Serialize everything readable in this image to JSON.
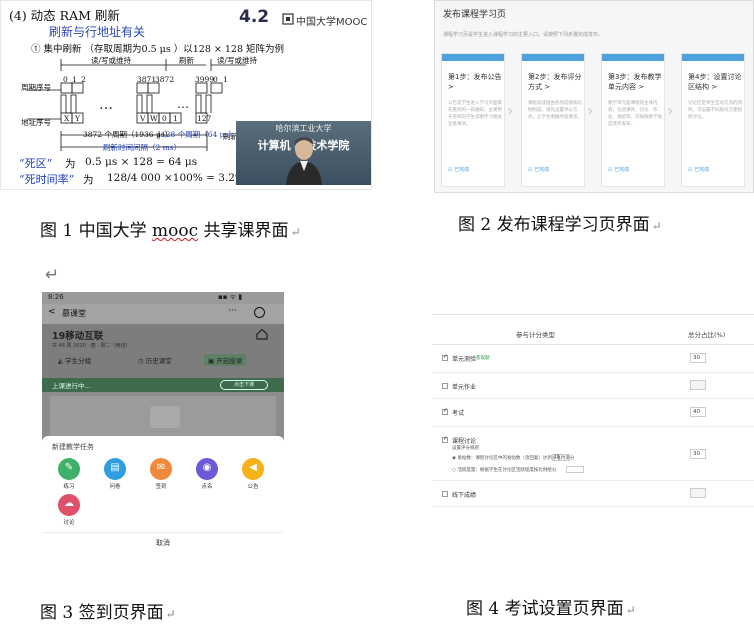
{
  "fig1": {
    "heading": "(4)  动态 RAM 刷新",
    "subheading": "刷新与行地址有关",
    "bullet": "① 集中刷新 （存取周期为0.5 μs ）以128 × 128 矩阵为例",
    "chapter": "4.2",
    "logo_text": "中国大学MOOC",
    "label_cycle": "周期序号",
    "label_addr": "地址序号",
    "label_rw1": "读/写或维持",
    "label_refresh": "刷新",
    "label_rw2": "读/写或维持",
    "label_refresh_seq": "刷新序号",
    "cycle_ticks": [
      "0",
      "1",
      "2",
      "3871",
      "3872",
      "3999",
      "0",
      "1"
    ],
    "addr_cells": [
      "X",
      "Y",
      "V",
      "W",
      "0",
      "1",
      "127"
    ],
    "ellipsis": "…",
    "span_1": "3872 个周期（1936 μs）",
    "span_2": "128 个周期（64 μs）",
    "span_total": "刷新时间间隔（2 ms）",
    "dead_zone_label": "“死区”",
    "dead_zone_word": "为",
    "dead_zone_value": "0.5 μs × 128 = 64 μs",
    "dead_rate_label": "“死时间率”",
    "dead_rate_word": "为",
    "dead_rate_value": "128/4 000 ×100% = 3.2%",
    "video_school": "哈尔滨工业大学",
    "video_college": "计算机    与技术学院"
  },
  "fig2": {
    "title": "发布课程学习页",
    "description": "课程学习页是学生进入课程学习的主要入口，请按照下列步骤完成发布。",
    "steps": [
      {
        "title": "第1步：发布公告 >",
        "desc": "公告是学生进入学习页面最先看到的一则通知，主要用于老师向学生说明学习相关注意事项。",
        "done": "已完成"
      },
      {
        "title": "第2步：发布评分方式 >",
        "desc": "课程总成绩由各项成绩按比例构成，请先设置评分方式，让学生明确考核要求。",
        "done": "已完成"
      },
      {
        "title": "第3步：发布教学单元内容 >",
        "desc": "教学单元是课程的主体内容，包括课件、讨论、作业、测验等，可按照教学进度逐步发布。",
        "done": "已完成"
      },
      {
        "title": "第4步：设置讨论区结构 >",
        "desc": "讨论区是师生互动交流的场所，可设置不同版块方便组织讨论。",
        "done": "已完成"
      }
    ]
  },
  "fig3": {
    "return_mark": "↵",
    "status_time": "8:26",
    "status_icons": "▪▪ ᯤ ▮",
    "back": "<",
    "app_title": "慕课堂",
    "more": "···",
    "course_name": "19移动互联",
    "course_info": "共 48 周 2020 · 春 · 周二（两班）",
    "chips": [
      "学生分组",
      "历史课堂",
      "开启授课"
    ],
    "live_text": "上课进行中...",
    "live_button": "点击下课",
    "sheet_title": "新建教学任务",
    "tasks": [
      {
        "label": "练习",
        "color": "#3fb06a",
        "glyph": "✎"
      },
      {
        "label": "问卷",
        "color": "#2f9ee0",
        "glyph": "▤"
      },
      {
        "label": "签到",
        "color": "#ef8a3c",
        "glyph": "✉"
      },
      {
        "label": "点名",
        "color": "#6b5ad8",
        "glyph": "◉"
      },
      {
        "label": "公告",
        "color": "#f5b21b",
        "glyph": "◀"
      },
      {
        "label": "讨论",
        "color": "#e0506a",
        "glyph": "☁"
      }
    ],
    "cancel": "取消"
  },
  "fig4": {
    "col_type": "参与计分类型",
    "col_ratio": "总分占比(%)",
    "rows": [
      {
        "label": "单元测验",
        "badge": "客观题",
        "checked": true,
        "value": "30"
      },
      {
        "label": "单元作业",
        "badge": "",
        "checked": false,
        "value": ""
      },
      {
        "label": "考试",
        "badge": "",
        "checked": true,
        "value": "40"
      },
      {
        "label": "课程讨论",
        "badge": "",
        "checked": true,
        "value": "30"
      },
      {
        "label": "线下成绩",
        "badge": "",
        "checked": false,
        "value": ""
      }
    ],
    "discuss_sub_title": "设置评分规则",
    "discuss_sub_a": "发帖数：课程讨论区中的发帖数（含回复）达到标准时满分",
    "discuss_sub_a_val": "15",
    "discuss_sub_b": "活跃度量：根据学生在讨论区活跃程度按比例给分",
    "discuss_sub_b_val": ""
  },
  "captions": {
    "c1_pre": "图 1 中国大学 ",
    "c1_mooc": "mooc",
    "c1_post": " 共享课界面",
    "c2": "图 2  发布课程学习页界面",
    "c3": "图 3 签到页界面",
    "c4": "图 4 考试设置页界面",
    "ret": "↵"
  }
}
